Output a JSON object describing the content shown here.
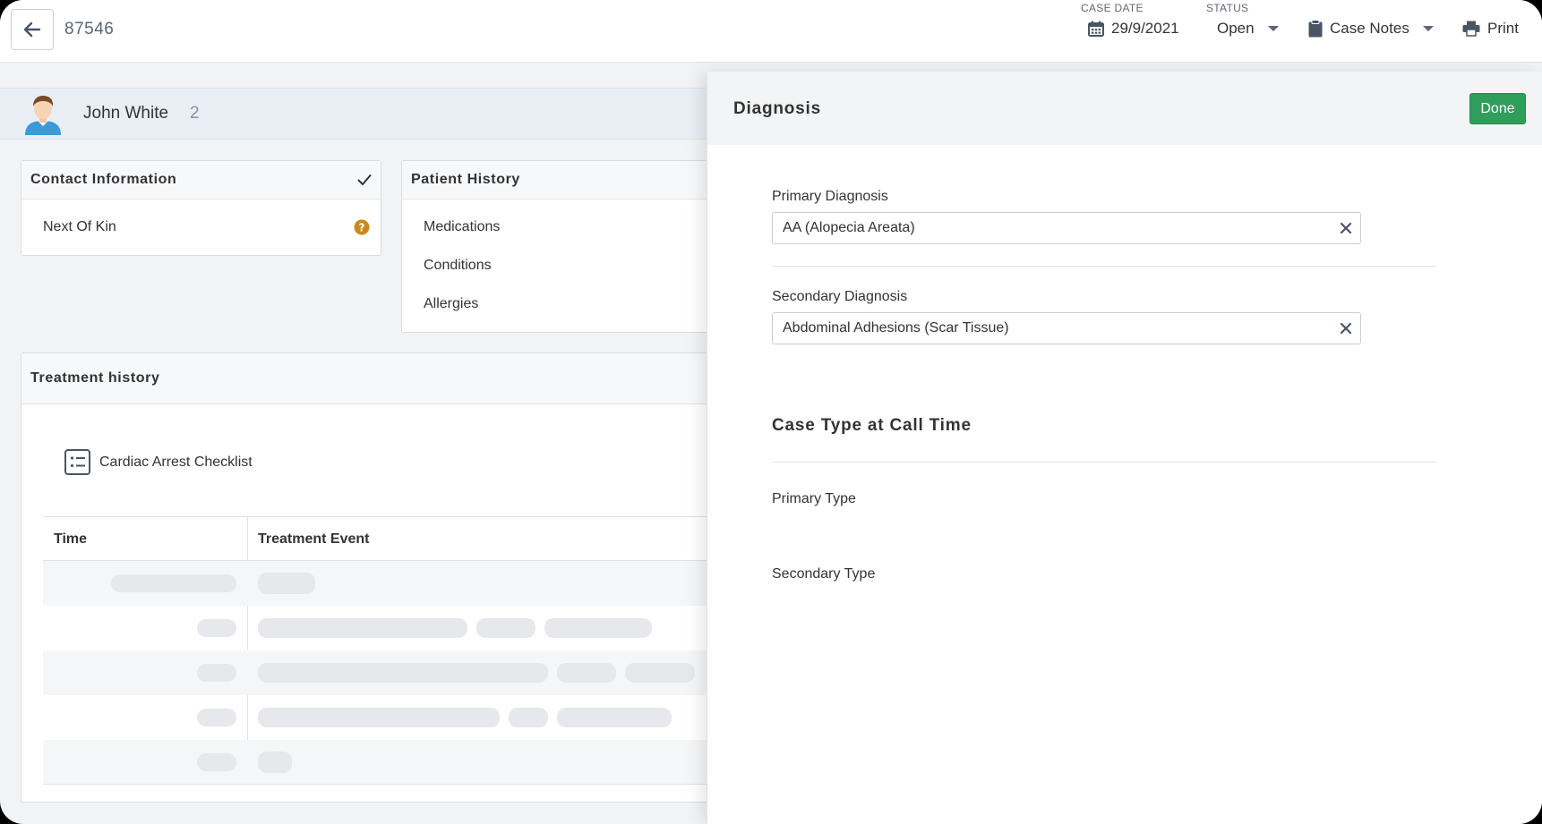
{
  "header": {
    "case_id": "87546",
    "case_date_label": "CASE DATE",
    "case_date": "29/9/2021",
    "status_label": "STATUS",
    "status": "Open",
    "case_notes": "Case Notes",
    "print": "Print"
  },
  "patient": {
    "name": "John White",
    "count": "2"
  },
  "contact_card": {
    "title": "Contact Information",
    "item": "Next Of Kin"
  },
  "history_card": {
    "title": "Patient History",
    "items": [
      "Medications",
      "Conditions",
      "Allergies"
    ]
  },
  "treatment": {
    "title": "Treatment history",
    "checklist": "Cardiac Arrest Checklist",
    "columns": [
      "Time",
      "Treatment Event"
    ]
  },
  "diagnosis_panel": {
    "title": "Diagnosis",
    "done": "Done",
    "primary_label": "Primary Diagnosis",
    "primary_value": "AA (Alopecia Areata)",
    "secondary_label": "Secondary Diagnosis",
    "secondary_value": "Abdominal Adhesions (Scar Tissue)",
    "case_type_title": "Case Type at Call Time",
    "primary_type_label": "Primary Type",
    "secondary_type_label": "Secondary Type"
  },
  "colors": {
    "accent_green": "#2f9e5b",
    "help_badge": "#c98a1b",
    "avatar_shirt": "#3a9bd8"
  }
}
